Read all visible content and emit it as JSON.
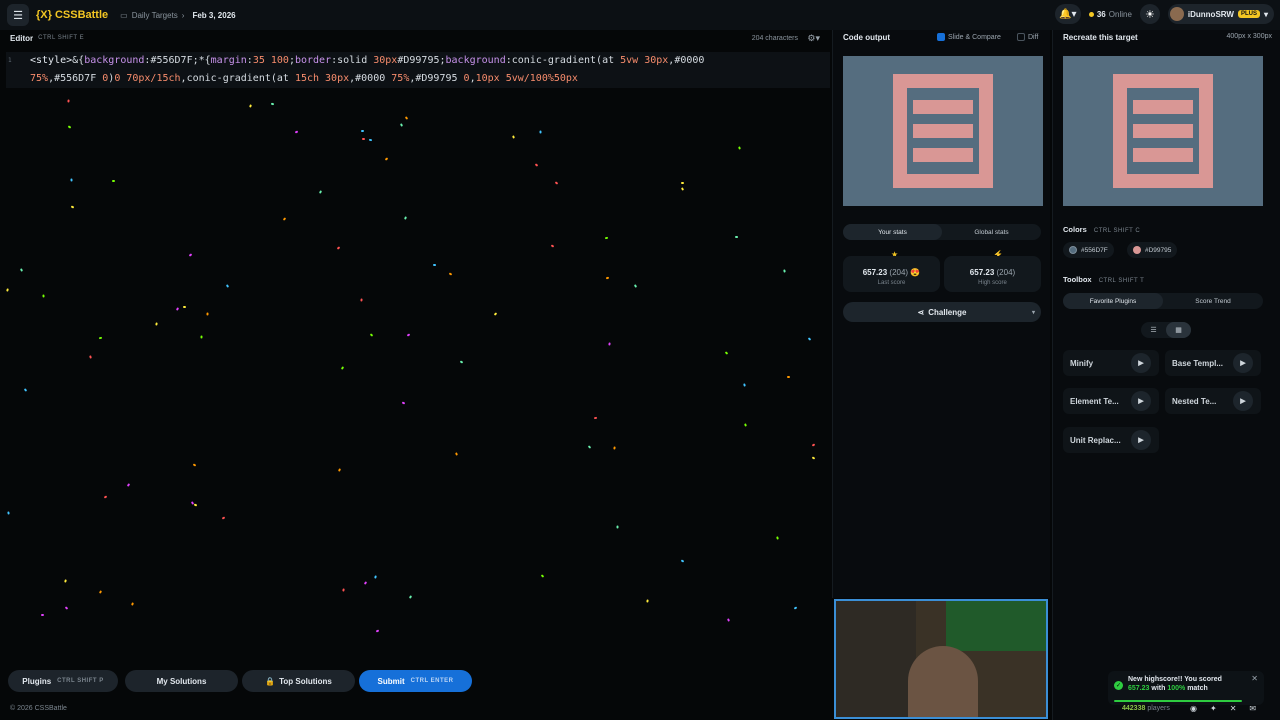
{
  "header": {
    "logo": "{X} CSSBattle",
    "breadcrumb": "Daily Targets",
    "date": "Feb 3, 2026",
    "online_count": "36",
    "online_label": "Online",
    "username": "iDunnoSRW",
    "plus_badge": "PLUS"
  },
  "editor": {
    "title": "Editor",
    "shortcut": "CTRL SHIFT E",
    "char_count": "204 characters",
    "line_number": "1"
  },
  "code_output": {
    "title": "Code output",
    "slide_compare": "Slide & Compare",
    "diff": "Diff"
  },
  "stats": {
    "tab_your": "Your stats",
    "tab_global": "Global stats",
    "last_score": "657.23",
    "last_count": "(204)",
    "last_label": "Last score",
    "high_score": "657.23",
    "high_count": "(204)",
    "high_label": "High score",
    "challenge": "Challenge"
  },
  "target": {
    "title": "Recreate this target",
    "size": "400px x 300px",
    "colors_label": "Colors",
    "colors_shortcut": "CTRL SHIFT C",
    "colors": [
      {
        "hex": "#556D7F"
      },
      {
        "hex": "#D99795"
      }
    ]
  },
  "toolbox": {
    "label": "Toolbox",
    "shortcut": "CTRL SHIFT T",
    "tab_fav": "Favorite Plugins",
    "tab_score": "Score Trend",
    "plugins": [
      "Minify",
      "Base Templ...",
      "Element Te...",
      "Nested Te...",
      "Unit Replac..."
    ]
  },
  "bottom": {
    "plugins": "Plugins",
    "plugins_shortcut": "CTRL SHIFT P",
    "my_solutions": "My Solutions",
    "top_solutions": "Top Solutions",
    "submit": "Submit",
    "submit_shortcut": "CTRL ENTER",
    "footer": "© 2026 CSSBattle"
  },
  "toast": {
    "line1": "New highscore!! You scored",
    "score": "657.23",
    "with": "with",
    "match": "100%",
    "match_label": "match"
  },
  "players": {
    "count": "442338",
    "label": "players"
  }
}
